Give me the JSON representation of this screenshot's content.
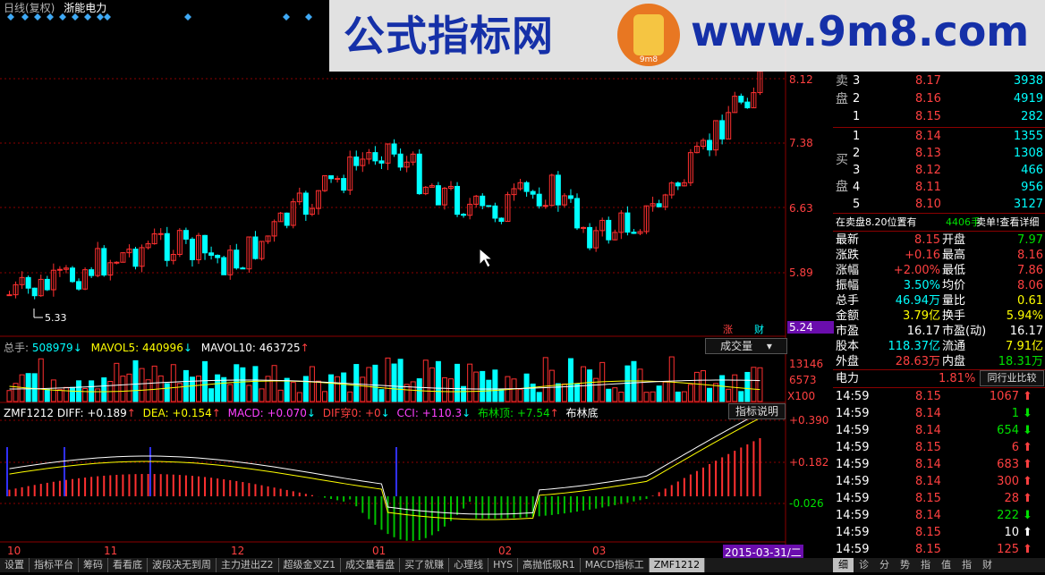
{
  "header": {
    "period": "日线(复权)",
    "stock_name": "浙能电力"
  },
  "watermark": {
    "cn": "公式指标网",
    "en": "www.9m8.com",
    "logo_text": "9m8"
  },
  "price_axis": [
    "8.12",
    "7.38",
    "6.63",
    "5.89",
    "5.24"
  ],
  "low_mark": "5.33",
  "badges": {
    "zhang": "涨",
    "cai": "财"
  },
  "volume_legend": {
    "zongshou_label": "总手:",
    "zongshou": "508979",
    "mavol5_label": "MAVOL5:",
    "mavol5": "440996",
    "mavol10_label": "MAVOL10:",
    "mavol10": "463725",
    "dropdown": "成交量",
    "axis": [
      "13146",
      "6573",
      "X100"
    ]
  },
  "indicator_legend": {
    "name": "ZMF1212",
    "diff": "DIFF: +0.189",
    "dea": "DEA: +0.154",
    "macd": "MACD: +0.070",
    "dif_cross": "DIF穿0: +0",
    "cci": "CCI: +110.3",
    "boll_top": "布林顶: +7.54",
    "boll_bottom": "布林底",
    "help_button": "指标说明",
    "axis": [
      "+0.390",
      "+0.182",
      "-0.026"
    ]
  },
  "time_axis": [
    "10",
    "11",
    "12",
    "01",
    "02",
    "03"
  ],
  "date_tag": "2015-03-31/二",
  "bottom_tabs": [
    "设置",
    "指标平台",
    "筹码",
    "看看底",
    "波段决无到周",
    "主力进出Z2",
    "超级金叉Z1",
    "成交量看盘",
    "买了就赚",
    "心理线",
    "HYS",
    "高抛低吸R1",
    "MACD指标工",
    "ZMF1212"
  ],
  "order_book": {
    "sell_label": [
      "卖",
      "盘"
    ],
    "buy_label": [
      "买",
      "盘"
    ],
    "sell": [
      {
        "level": "3",
        "price": "8.17",
        "vol": "3938"
      },
      {
        "level": "2",
        "price": "8.16",
        "vol": "4919"
      },
      {
        "level": "1",
        "price": "8.15",
        "vol": "282"
      }
    ],
    "buy": [
      {
        "level": "1",
        "price": "8.14",
        "vol": "1355"
      },
      {
        "level": "2",
        "price": "8.13",
        "vol": "1308"
      },
      {
        "level": "3",
        "price": "8.12",
        "vol": "466"
      },
      {
        "level": "4",
        "price": "8.11",
        "vol": "956"
      },
      {
        "level": "5",
        "price": "8.10",
        "vol": "3127"
      }
    ]
  },
  "position_line": {
    "text": "在卖盘8.20位置有",
    "qty": "4406手",
    "action": "卖单!查看详细"
  },
  "quote": [
    {
      "k1": "最新",
      "v1": "8.15",
      "k2": "开盘",
      "v2": "7.97"
    },
    {
      "k1": "涨跌",
      "v1": "+0.16",
      "k2": "最高",
      "v2": "8.16"
    },
    {
      "k1": "涨幅",
      "v1": "+2.00%",
      "k2": "最低",
      "v2": "7.86"
    },
    {
      "k1": "振幅",
      "v1": "3.50%",
      "k2": "均价",
      "v2": "8.06"
    },
    {
      "k1": "总手",
      "v1": "46.94万",
      "k2": "量比",
      "v2": "0.61"
    },
    {
      "k1": "金额",
      "v1": "3.79亿",
      "k2": "换手",
      "v2": "5.94%"
    },
    {
      "k1": "市盈",
      "v1": "16.17",
      "k2": "市盈(动)",
      "v2": "16.17"
    },
    {
      "k1": "股本",
      "v1": "118.37亿",
      "k2": "流通",
      "v2": "7.91亿"
    },
    {
      "k1": "外盘",
      "v1": "28.63万",
      "k2": "内盘",
      "v2": "18.31万"
    }
  ],
  "sector": {
    "name": "电力",
    "pct": "1.81%",
    "compare_button": "同行业比较"
  },
  "ticks": [
    {
      "time": "14:59",
      "price": "8.15",
      "vol": "1067",
      "dir": "up"
    },
    {
      "time": "14:59",
      "price": "8.14",
      "vol": "1",
      "dir": "down"
    },
    {
      "time": "14:59",
      "price": "8.14",
      "vol": "654",
      "dir": "down"
    },
    {
      "time": "14:59",
      "price": "8.15",
      "vol": "6",
      "dir": "up"
    },
    {
      "time": "14:59",
      "price": "8.14",
      "vol": "683",
      "dir": "up"
    },
    {
      "time": "14:59",
      "price": "8.14",
      "vol": "300",
      "dir": "up"
    },
    {
      "time": "14:59",
      "price": "8.15",
      "vol": "28",
      "dir": "up"
    },
    {
      "time": "14:59",
      "price": "8.14",
      "vol": "222",
      "dir": "down"
    },
    {
      "time": "14:59",
      "price": "8.15",
      "vol": "10",
      "dir": "neutral"
    },
    {
      "time": "14:59",
      "price": "8.15",
      "vol": "125",
      "dir": "up"
    }
  ],
  "right_tabs": [
    "细",
    "诊",
    "分",
    "势",
    "指",
    "值",
    "指",
    "财"
  ],
  "colors": {
    "up": "#ff3030",
    "down": "#00ffff",
    "grid": "#8b0000",
    "volume_up": "#ff3030",
    "volume_down": "#00ffff"
  }
}
